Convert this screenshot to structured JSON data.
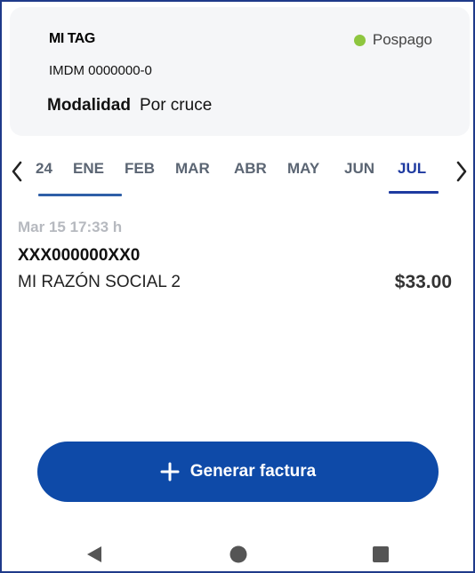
{
  "colors": {
    "primary": "#0e4aa8",
    "status_green": "#8ec63f",
    "active_month": "#1e3aa0",
    "inactive_underline": "#2f5fa8",
    "nav_gray": "#555555"
  },
  "tag": {
    "title": "MI TAG",
    "status": "Pospago",
    "id": "IMDM 0000000-0",
    "mode_label": "Modalidad",
    "mode_value": "Por cruce"
  },
  "months": {
    "prev_icon": "chevron-left-icon",
    "next_icon": "chevron-right-icon",
    "items": [
      {
        "label": "24"
      },
      {
        "label": "ENE"
      },
      {
        "label": "FEB"
      },
      {
        "label": "MAR"
      },
      {
        "label": "ABR"
      },
      {
        "label": "MAY"
      },
      {
        "label": "JUN"
      },
      {
        "label": "JUL"
      }
    ],
    "selected": "JUL"
  },
  "transaction": {
    "date": "Mar 15 17:33 h",
    "plate": "XXX000000XX0",
    "business_name": "MI RAZÓN SOCIAL 2",
    "amount": "$33.00"
  },
  "action": {
    "icon": "plus-icon",
    "label": "Generar factura"
  },
  "system_nav": {
    "back_icon": "back-triangle-icon",
    "home_icon": "home-circle-icon",
    "recents_icon": "recents-square-icon"
  }
}
